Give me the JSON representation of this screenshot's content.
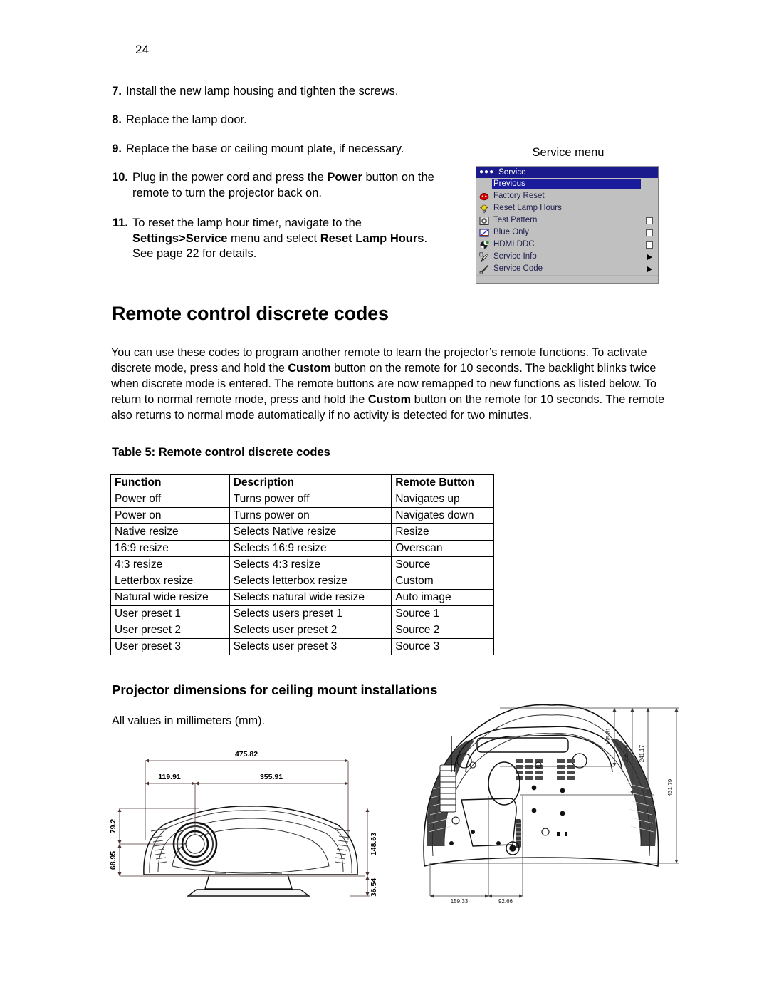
{
  "page": {
    "number": "24"
  },
  "steps": [
    {
      "num": "7.",
      "text": "Install the new lamp housing and tighten the screws."
    },
    {
      "num": "8.",
      "text": "Replace the lamp door."
    },
    {
      "num": "9.",
      "text": "Replace the base or ceiling mount plate, if necessary."
    },
    {
      "num": "10.",
      "text": "Plug in the power cord and press the Power button on the remote to turn the projector back on."
    },
    {
      "num": "11.",
      "text": "To reset the lamp hour timer, navigate to the Settings>Service menu and select Reset Lamp Hours. See page 22 for details."
    }
  ],
  "service_figure": {
    "caption": "Service menu",
    "title": "Service",
    "rows": [
      {
        "label": "Previous",
        "icon": "none",
        "control": "none",
        "selected": true
      },
      {
        "label": "Factory Reset",
        "icon": "factory-reset-icon",
        "control": "none",
        "selected": false
      },
      {
        "label": "Reset Lamp Hours",
        "icon": "lamp-icon",
        "control": "none",
        "selected": false
      },
      {
        "label": "Test Pattern",
        "icon": "test-pattern-icon",
        "control": "checkbox",
        "selected": false
      },
      {
        "label": "Blue Only",
        "icon": "blue-only-icon",
        "control": "checkbox",
        "selected": false
      },
      {
        "label": "HDMI DDC",
        "icon": "hdmi-ddc-icon",
        "control": "checkbox",
        "selected": false
      },
      {
        "label": "Service Info",
        "icon": "service-info-icon",
        "control": "arrow",
        "selected": false
      },
      {
        "label": "Service Code",
        "icon": "service-code-icon",
        "control": "arrow",
        "selected": false
      }
    ]
  },
  "section": {
    "title": "Remote control discrete codes",
    "paragraph_parts": [
      {
        "t": "You can use these codes to program another remote to learn the projector’s remote functions. To activate discrete mode, press and hold the ",
        "b": false
      },
      {
        "t": "Custom",
        "b": true
      },
      {
        "t": " button on the remote for 10 seconds. The backlight blinks twice when discrete mode is entered. The remote buttons are now remapped to new functions as listed below. To return to normal remote mode, press and hold the ",
        "b": false
      },
      {
        "t": "Custom",
        "b": true
      },
      {
        "t": " button on the remote for 10 seconds. The remote also returns to normal mode automatically if no activity is detected for two minutes.",
        "b": false
      }
    ]
  },
  "table": {
    "caption": "Table 5: Remote control discrete codes",
    "headers": [
      "Function",
      "Description",
      "Remote Button"
    ],
    "rows": [
      [
        "Power off",
        "Turns power off",
        "Navigates up"
      ],
      [
        "Power on",
        "Turns power on",
        "Navigates down"
      ],
      [
        "Native resize",
        "Selects Native resize",
        "Resize"
      ],
      [
        "16:9 resize",
        "Selects 16:9 resize",
        "Overscan"
      ],
      [
        "4:3 resize",
        "Selects 4:3 resize",
        "Source"
      ],
      [
        "Letterbox resize",
        "Selects letterbox resize",
        "Custom"
      ],
      [
        "Natural wide resize",
        "Selects natural wide resize",
        "Auto image"
      ],
      [
        "User preset 1",
        "Selects users preset 1",
        "Source 1"
      ],
      [
        "User preset 2",
        "Selects user preset 2",
        "Source 2"
      ],
      [
        "User preset 3",
        "Selects user preset 3",
        "Source 3"
      ]
    ]
  },
  "dimensions_section": {
    "title": "Projector dimensions for ceiling mount installations",
    "note": "All values in millimeters (mm)."
  },
  "drawing_front": {
    "name": "projector-front-view",
    "labels": {
      "overall_width": "475.82",
      "left_offset": "119.91",
      "right_offset": "355.91",
      "lens_height_upper": "79.2",
      "lens_height_lower": "68.95",
      "body_height": "148.63",
      "foot_height": "36.54"
    }
  },
  "drawing_bottom": {
    "name": "projector-bottom-view",
    "labels": {
      "depth_1": "155.81",
      "depth_2": "235.46",
      "depth_3": "241.17",
      "depth_4": "431.79",
      "width_1": "159.33",
      "width_2": "92.66"
    }
  }
}
